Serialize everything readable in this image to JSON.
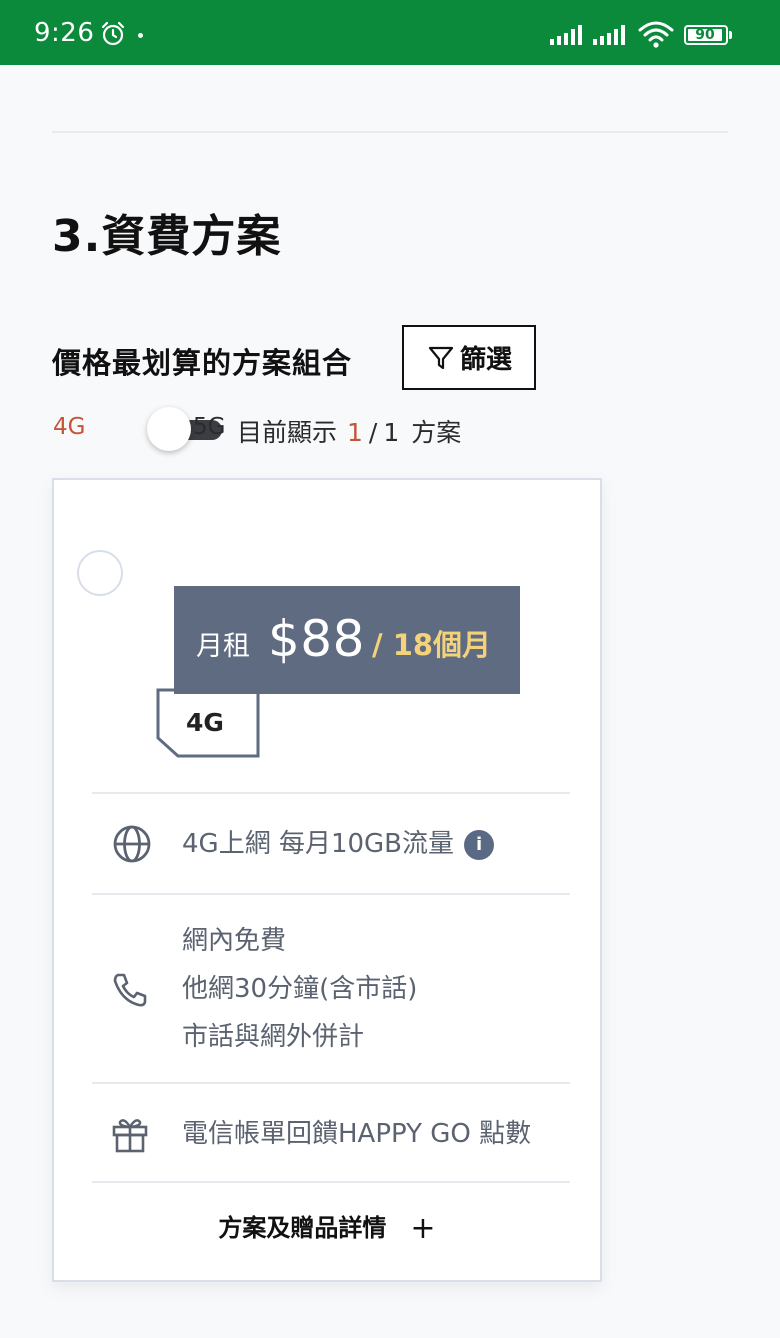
{
  "status_bar": {
    "time": "9:26",
    "battery": "90",
    "icons": [
      "alarm-icon",
      "signal-icon",
      "signal-icon",
      "wifi-icon",
      "battery-icon"
    ],
    "background_color": "#0b8a3c"
  },
  "section": {
    "title": "3.資費方案"
  },
  "combo": {
    "title": "價格最划算的方案組合",
    "filter_label": "篩選",
    "filter_icon": "funnel-icon"
  },
  "network_toggle": {
    "left_label": "4G",
    "right_label": "5G",
    "selected": "4G",
    "showing_prefix": "目前顯示",
    "current": "1",
    "separator": "/",
    "total": "1",
    "unit": "方案"
  },
  "plan": {
    "price_prefix": "月租",
    "price": "$88",
    "period": "/ 18個月",
    "network_badge": "4G",
    "features": [
      {
        "icon": "globe-icon",
        "lines": [
          "4G上網 每月10GB流量"
        ],
        "has_info": true,
        "info_glyph": "i"
      },
      {
        "icon": "phone-icon",
        "lines": [
          "網內免費",
          "他網30分鐘(含市話)",
          "市話與網外併計"
        ]
      },
      {
        "icon": "gift-icon",
        "lines": [
          "電信帳單回饋HAPPY GO 點數"
        ]
      }
    ],
    "details_label": "方案及贈品詳情",
    "details_icon": "+"
  },
  "colors": {
    "accent_orange": "#c4553a",
    "price_tag_bg": "#5f6b80",
    "period_yellow": "#f3d27a",
    "card_border": "#d8dfea"
  }
}
